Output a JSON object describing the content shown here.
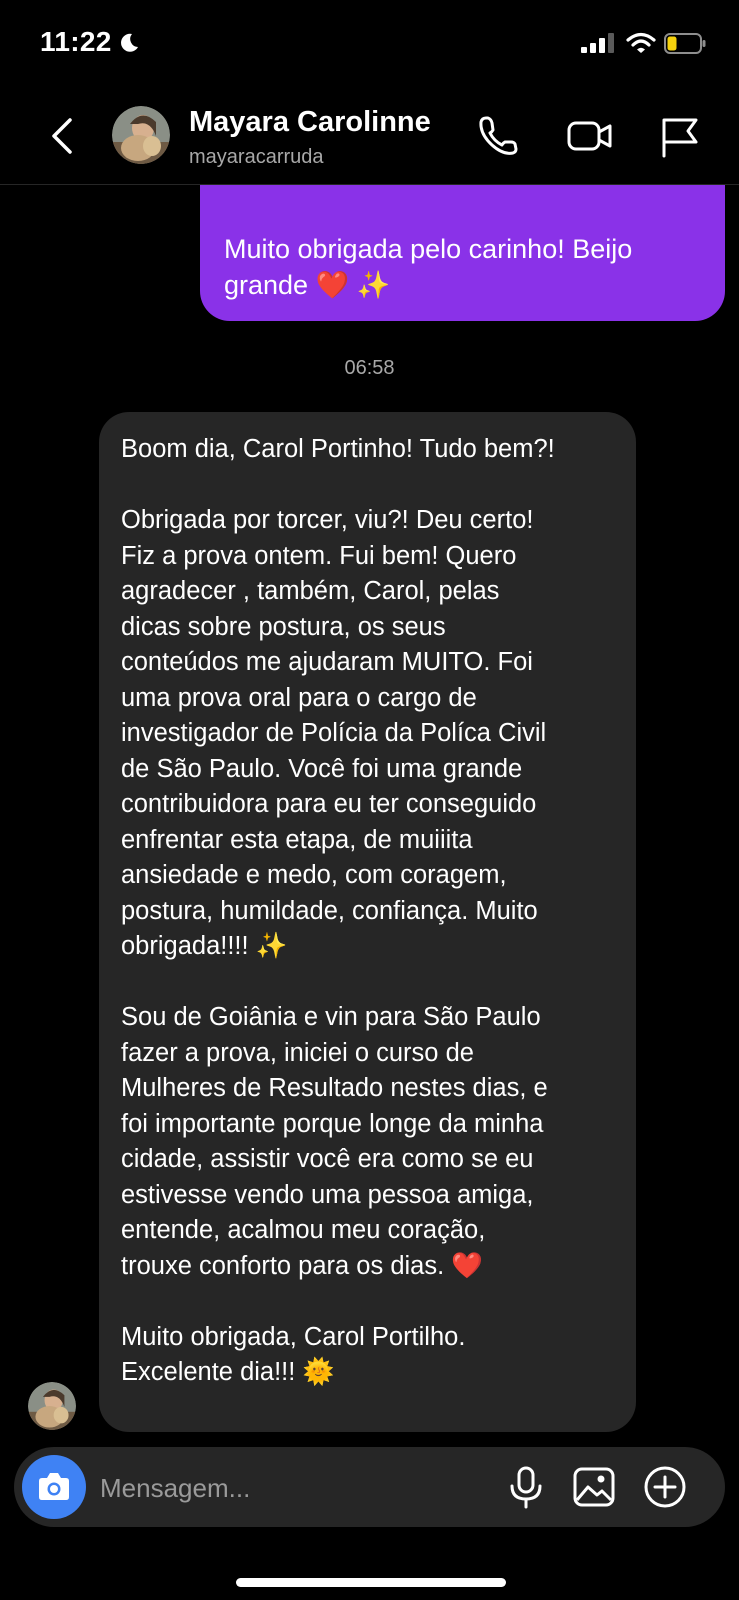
{
  "status_bar": {
    "time": "11:22",
    "icons": [
      "moon-icon",
      "cellular-signal-icon",
      "wifi-icon",
      "battery-low-icon"
    ]
  },
  "header": {
    "contact_name": "Mayara Carolinne",
    "username": "mayaracarruda",
    "icons": [
      "back-chevron-icon",
      "phone-call-icon",
      "video-call-icon",
      "flag-icon"
    ]
  },
  "messages": {
    "sent": {
      "text": "Muito obrigada pelo carinho! Beijo\ngrande ❤️ ✨"
    },
    "timestamp": "06:58",
    "received": {
      "paragraphs": [
        "Boom dia, Carol Portinho! Tudo bem?!",
        "Obrigada por torcer, viu?! Deu certo!\nFiz a prova ontem. Fui bem! Quero\nagradecer , também, Carol, pelas\ndicas sobre postura, os seus\nconteúdos me ajudaram MUITO. Foi\numa prova oral  para o cargo de\ninvestigador de Polícia da Políca Civil\nde São Paulo. Você foi uma grande\ncontribuidora para eu ter conseguido\nenfrentar esta etapa, de muiiita\nansiedade e medo, com coragem,\npostura, humildade, confiança. Muito\nobrigada!!!! ✨",
        "Sou de Goiânia e vin para São Paulo\nfazer a prova, iniciei o curso de\nMulheres de Resultado nestes dias, e\nfoi importante porque longe da minha\ncidade, assistir você era como se eu\nestivesse vendo uma pessoa amiga,\nentende, acalmou meu coração,\ntrouxe conforto para os dias. ❤️",
        "Muito obrigada, Carol Portilho.\nExcelente dia!!! 🌞"
      ]
    }
  },
  "composer": {
    "placeholder": "Mensagem...",
    "icons": [
      "camera-icon",
      "microphone-icon",
      "gallery-icon",
      "add-icon"
    ]
  },
  "colors": {
    "background": "#000000",
    "sent_bubble": "#8a32e8",
    "received_bubble": "#262626",
    "camera_button": "#3f82f4",
    "battery_level": "#f5d20d"
  }
}
